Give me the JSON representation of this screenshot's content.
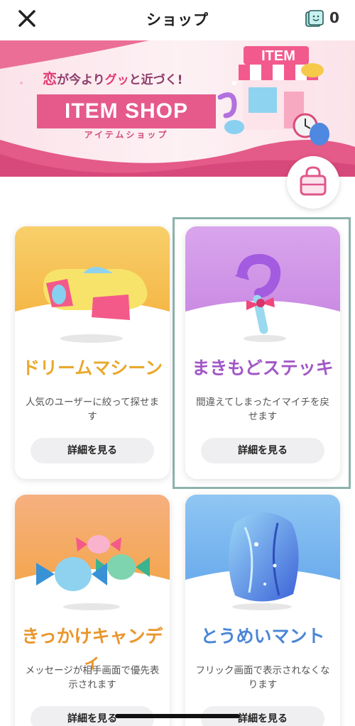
{
  "header": {
    "title": "ショップ",
    "ticket_count": "0"
  },
  "banner": {
    "tagline_love": "恋",
    "tagline_part1": "が今より",
    "tagline_gu": "グッ",
    "tagline_part2": "と近づく!",
    "main": "ITEM SHOP",
    "sub": "アイテムショップ",
    "shop_sign": "ITEM"
  },
  "items": [
    {
      "name": "ドリームマシーン",
      "description": "人気のユーザーに絞って探せます",
      "button": "詳細を見る",
      "name_color": "#e9a92c"
    },
    {
      "name": "まきもどステッキ",
      "description": "間違えてしまったイマイチを戻せます",
      "button": "詳細を見る",
      "name_color": "#a157c6"
    },
    {
      "name": "きっかけキャンディ",
      "description": "メッセージが相手画面で優先表示されます",
      "button": "詳細を見る",
      "name_color": "#e9962c"
    },
    {
      "name": "とうめいマント",
      "description": "フリック画面で表示されなくなります",
      "button": "詳細を見る",
      "name_color": "#4b86d6"
    }
  ],
  "colors": {
    "accent_pink": "#e55a8b",
    "selection_frame": "#8db2ac"
  }
}
